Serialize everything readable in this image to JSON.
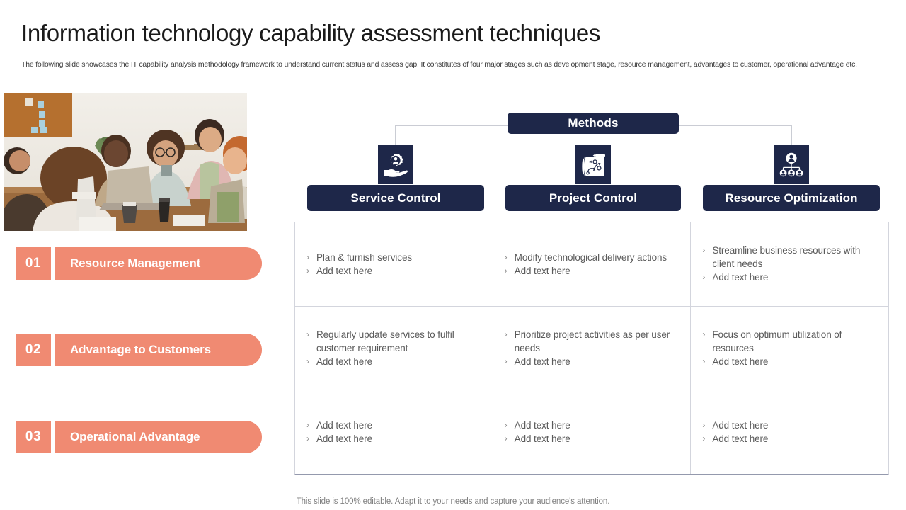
{
  "header": {
    "title": "Information technology capability assessment techniques",
    "subtitle": "The following slide showcases the IT capability analysis methodology framework to understand current status and assess gap. It constitutes of four major stages such as development stage, resource management, advantages to customer, operational advantage etc."
  },
  "photo": {
    "alt": "business team meeting around table with laptops"
  },
  "steps": [
    {
      "number": "01",
      "label": "Resource Management"
    },
    {
      "number": "02",
      "label": "Advantage to Customers"
    },
    {
      "number": "03",
      "label": "Operational Advantage"
    }
  ],
  "diagram": {
    "root_label": "Methods",
    "branches": [
      {
        "label": "Service Control",
        "icon": "hand-gear-person-icon"
      },
      {
        "label": "Project Control",
        "icon": "strategy-board-icon"
      },
      {
        "label": "Resource Optimization",
        "icon": "org-hierarchy-icon"
      }
    ]
  },
  "table": {
    "columns": [
      "Service Control",
      "Project Control",
      "Resource Optimization"
    ],
    "rows": [
      [
        [
          "Plan & furnish  services",
          "Add text here"
        ],
        [
          "Modify technological delivery actions",
          "Add text here"
        ],
        [
          "Streamline business resources with client needs",
          "Add text here"
        ]
      ],
      [
        [
          "Regularly  update services to fulfil customer requirement",
          "Add text here"
        ],
        [
          "Prioritize project activities as per user needs",
          "Add text here"
        ],
        [
          "Focus on optimum utilization of resources",
          "Add text here"
        ]
      ],
      [
        [
          "Add text here",
          "Add text here"
        ],
        [
          "Add text here",
          "Add text here"
        ],
        [
          "Add text here",
          "Add text here"
        ]
      ]
    ],
    "bullet_glyph": "›"
  },
  "footer": {
    "note": "This slide is 100% editable. Adapt it to your needs and capture your audience's attention."
  },
  "colors": {
    "navy": "#1e2749",
    "coral": "#f08a72",
    "border": "#d3d5dd",
    "body_text": "#5a5a5a"
  }
}
